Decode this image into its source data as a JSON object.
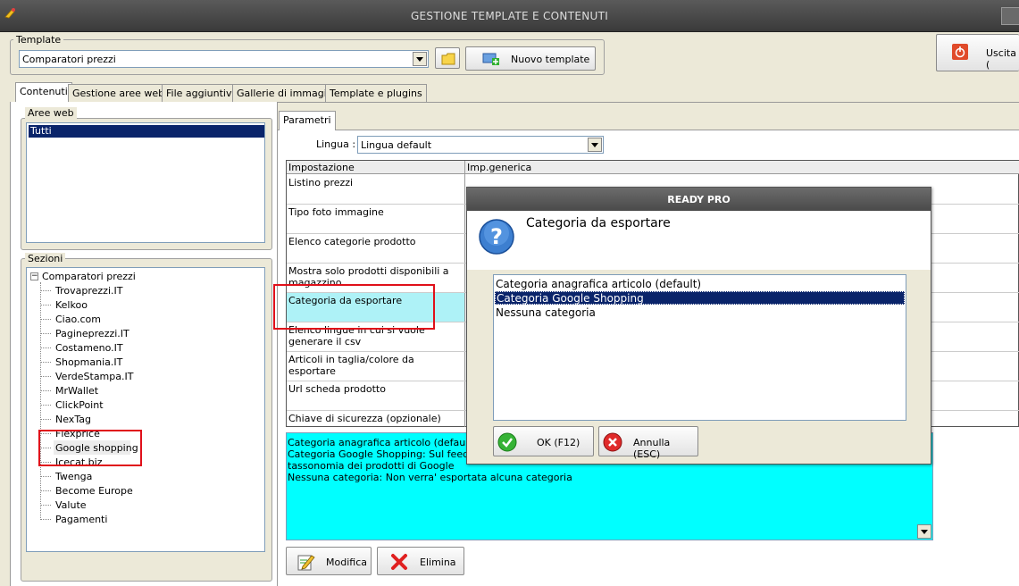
{
  "window": {
    "title": "GESTIONE TEMPLATE E CONTENUTI"
  },
  "template": {
    "group_label": "Template",
    "selected": "Comparatori prezzi",
    "new_button": "Nuovo template",
    "exit_button": "Uscita ("
  },
  "tabs": [
    "Contenuti",
    "Gestione aree web",
    "File aggiuntivi",
    "Gallerie di immagini",
    "Template e plugins"
  ],
  "aree_web": {
    "label": "Aree web",
    "items": [
      "Tutti"
    ]
  },
  "sezioni": {
    "label": "Sezioni",
    "root": "Comparatori prezzi",
    "items": [
      "Trovaprezzi.IT",
      "Kelkoo",
      "Ciao.com",
      "Pagineprezzi.IT",
      "Costameno.IT",
      "Shopmania.IT",
      "VerdeStampa.IT",
      "MrWallet",
      "ClickPoint",
      "NexTag",
      "Flexprice",
      "Google shopping",
      "Icecat.biz",
      "Twenga",
      "Become Europe",
      "Valute",
      "Pagamenti"
    ]
  },
  "parametri": {
    "tab": "Parametri",
    "lingua_label": "Lingua :",
    "lingua_value": "Lingua default",
    "col_impostazione": "Impostazione",
    "col_generica": "Imp.generica",
    "rows": [
      "Listino prezzi",
      "Tipo foto immagine",
      "Elenco categorie prodotto",
      "Mostra solo prodotti disponibili a magazzino",
      "Categoria da esportare",
      "Elenco lingue in cui si vuole generare il csv",
      "Articoli in taglia/colore da esportare",
      "Url scheda prodotto",
      "Chiave di sicurezza (opzionale)"
    ],
    "description_lines": [
      "Categoria anagrafica articolo (default): Su",
      "Categoria Google Shopping: Sul feed verra",
      "tassonomia dei prodotti di Google",
      "Nessuna categoria: Non verra' esportata alcuna categoria"
    ]
  },
  "buttons": {
    "modifica": "Modifica",
    "elimina": "Elimina"
  },
  "dialog": {
    "title": "READY PRO",
    "heading": "Categoria da esportare",
    "options": [
      "Categoria anagrafica articolo (default)",
      "Categoria Google Shopping",
      "Nessuna categoria"
    ],
    "selected_index": 1,
    "ok": "OK (F12)",
    "cancel": "Annulla (ESC)"
  },
  "colors": {
    "selection": "#0a246a",
    "description_bg": "#00ffff",
    "highlight_row": "#aef2f7",
    "red_annotation": "#e0101a"
  }
}
